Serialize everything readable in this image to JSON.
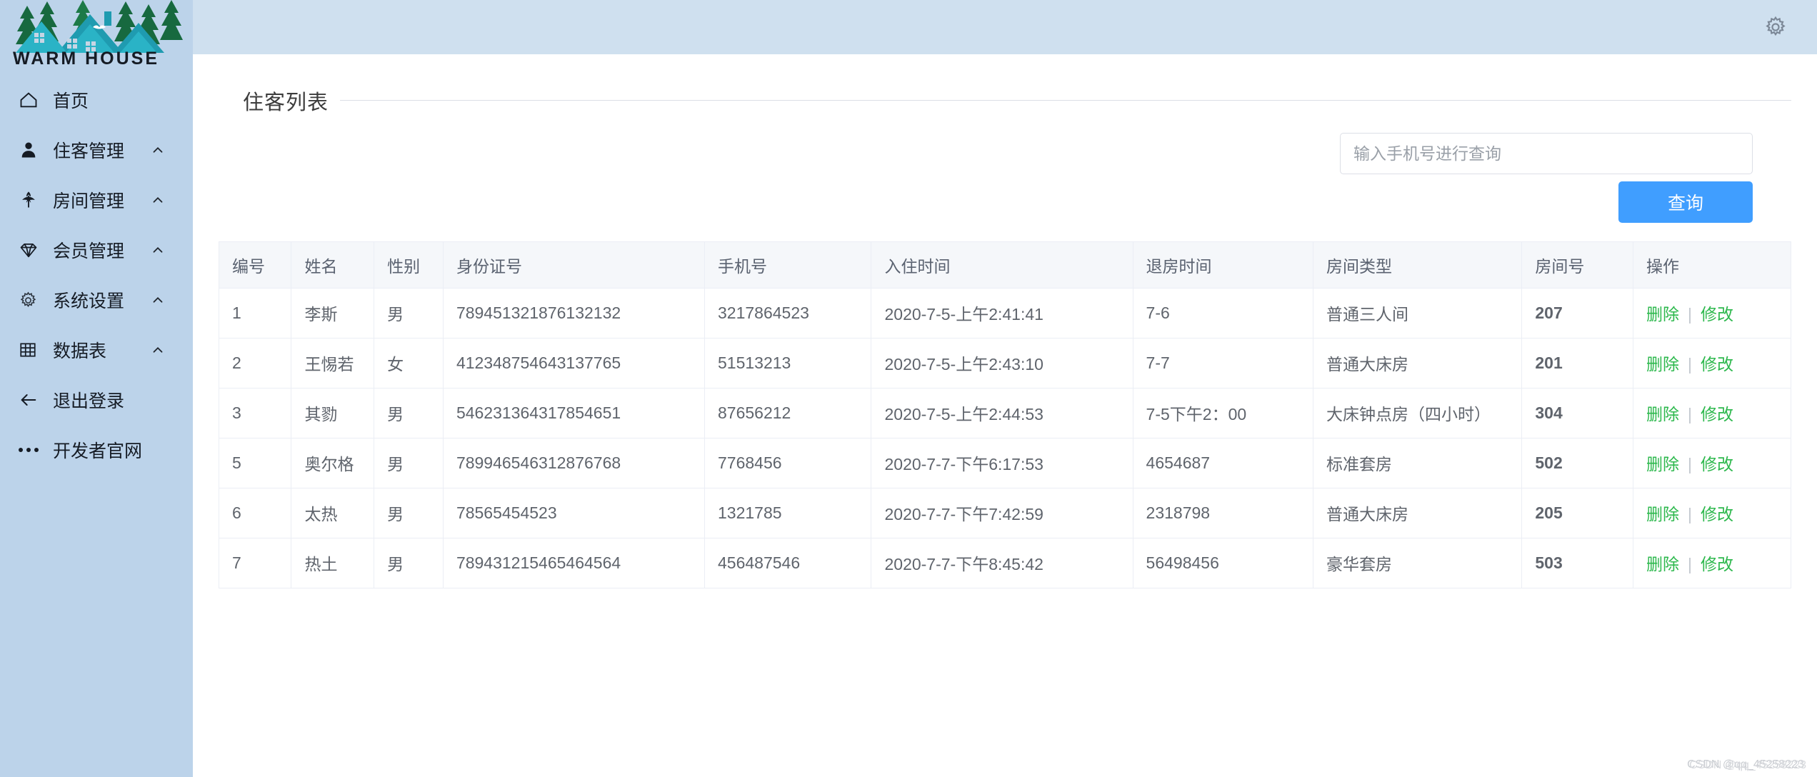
{
  "brand": {
    "name": "WARM HOUSE",
    "logo_icon": "house-mountain-trees-logo"
  },
  "sidebar": {
    "items": [
      {
        "label": "首页",
        "icon": "home-icon",
        "arrow": ""
      },
      {
        "label": "住客管理",
        "icon": "user-icon",
        "arrow": "chevron-up-icon"
      },
      {
        "label": "房间管理",
        "icon": "plant-icon",
        "arrow": "chevron-up-icon"
      },
      {
        "label": "会员管理",
        "icon": "diamond-icon",
        "arrow": "chevron-up-icon"
      },
      {
        "label": "系统设置",
        "icon": "gear-icon",
        "arrow": "chevron-up-icon"
      },
      {
        "label": "数据表",
        "icon": "grid-icon",
        "arrow": "chevron-up-icon"
      },
      {
        "label": "退出登录",
        "icon": "arrow-left-icon",
        "arrow": ""
      },
      {
        "label": "开发者官网",
        "icon": "ellipsis-icon",
        "arrow": ""
      }
    ]
  },
  "topbar": {
    "settings_icon": "gear-icon"
  },
  "panel": {
    "title": "住客列表"
  },
  "search": {
    "placeholder": "输入手机号进行查询",
    "value": "",
    "button_label": "查询"
  },
  "table": {
    "columns": [
      "编号",
      "姓名",
      "性别",
      "身份证号",
      "手机号",
      "入住时间",
      "退房时间",
      "房间类型",
      "房间号",
      "操作"
    ],
    "actions": {
      "delete": "删除",
      "separator": "|",
      "edit": "修改"
    },
    "rows": [
      {
        "id": "1",
        "name": "李斯",
        "gender": "男",
        "idcard": "789451321876132132",
        "phone": "3217864523",
        "checkin": "2020-7-5-上午2:41:41",
        "checkout": "7-6",
        "room_type": "普通三人间",
        "room_no": "207"
      },
      {
        "id": "2",
        "name": "王惕若",
        "gender": "女",
        "idcard": "412348754643137765",
        "phone": "51513213",
        "checkin": "2020-7-5-上午2:43:10",
        "checkout": "7-7",
        "room_type": "普通大床房",
        "room_no": "201"
      },
      {
        "id": "3",
        "name": "其勠",
        "gender": "男",
        "idcard": "546231364317854651",
        "phone": "87656212",
        "checkin": "2020-7-5-上午2:44:53",
        "checkout": "7-5下午2：00",
        "room_type": "大床钟点房（四小时）",
        "room_no": "304"
      },
      {
        "id": "5",
        "name": "奥尔格",
        "gender": "男",
        "idcard": "789946546312876768",
        "phone": "7768456",
        "checkin": "2020-7-7-下午6:17:53",
        "checkout": "4654687",
        "room_type": "标准套房",
        "room_no": "502"
      },
      {
        "id": "6",
        "name": "太热",
        "gender": "男",
        "idcard": "78565454523",
        "phone": "1321785",
        "checkin": "2020-7-7-下午7:42:59",
        "checkout": "2318798",
        "room_type": "普通大床房",
        "room_no": "205"
      },
      {
        "id": "7",
        "name": "热土",
        "gender": "男",
        "idcard": "789431215465464564",
        "phone": "456487546",
        "checkin": "2020-7-7-下午8:45:42",
        "checkout": "56498456",
        "room_type": "豪华套房",
        "room_no": "503"
      }
    ]
  },
  "watermark": {
    "text": "CSDN @qq_45258223"
  },
  "colors": {
    "sidebar_bg": "#bcd3ea",
    "topbar_bg": "#cfe0ef",
    "primary": "#409eff",
    "action_link": "#2db84d",
    "table_header_bg": "#f5f7fa",
    "border": "#ebeef5"
  }
}
